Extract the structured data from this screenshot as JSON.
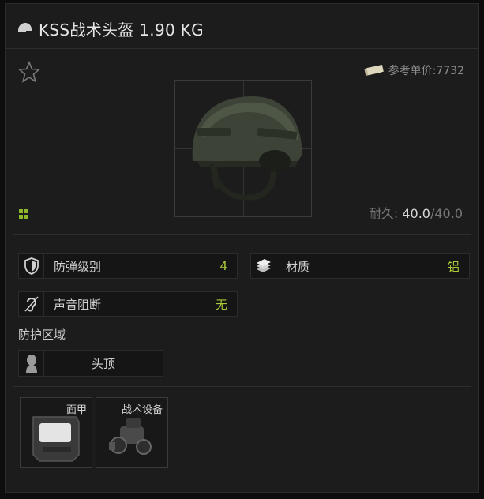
{
  "item": {
    "title": "KSS战术头盔 1.90 KG",
    "price_label": "参考单价:7732",
    "durability_label": "耐久:",
    "durability_current": "40.0",
    "durability_max": "/40.0"
  },
  "stats": [
    {
      "label": "防弹级别",
      "value": "4",
      "icon": "shield-icon"
    },
    {
      "label": "材质",
      "value": "铝",
      "icon": "material-icon"
    },
    {
      "label": "声音阻断",
      "value": "无",
      "icon": "ear-icon"
    }
  ],
  "protection": {
    "label": "防护区域",
    "zone": "头顶"
  },
  "slots": [
    {
      "name": "面甲",
      "icon": "faceshield-icon"
    },
    {
      "name": "战术设备",
      "icon": "night-vision-icon"
    }
  ],
  "colors": {
    "value_accent": "#a9c93a",
    "grid_icon": "#8fb82a"
  }
}
